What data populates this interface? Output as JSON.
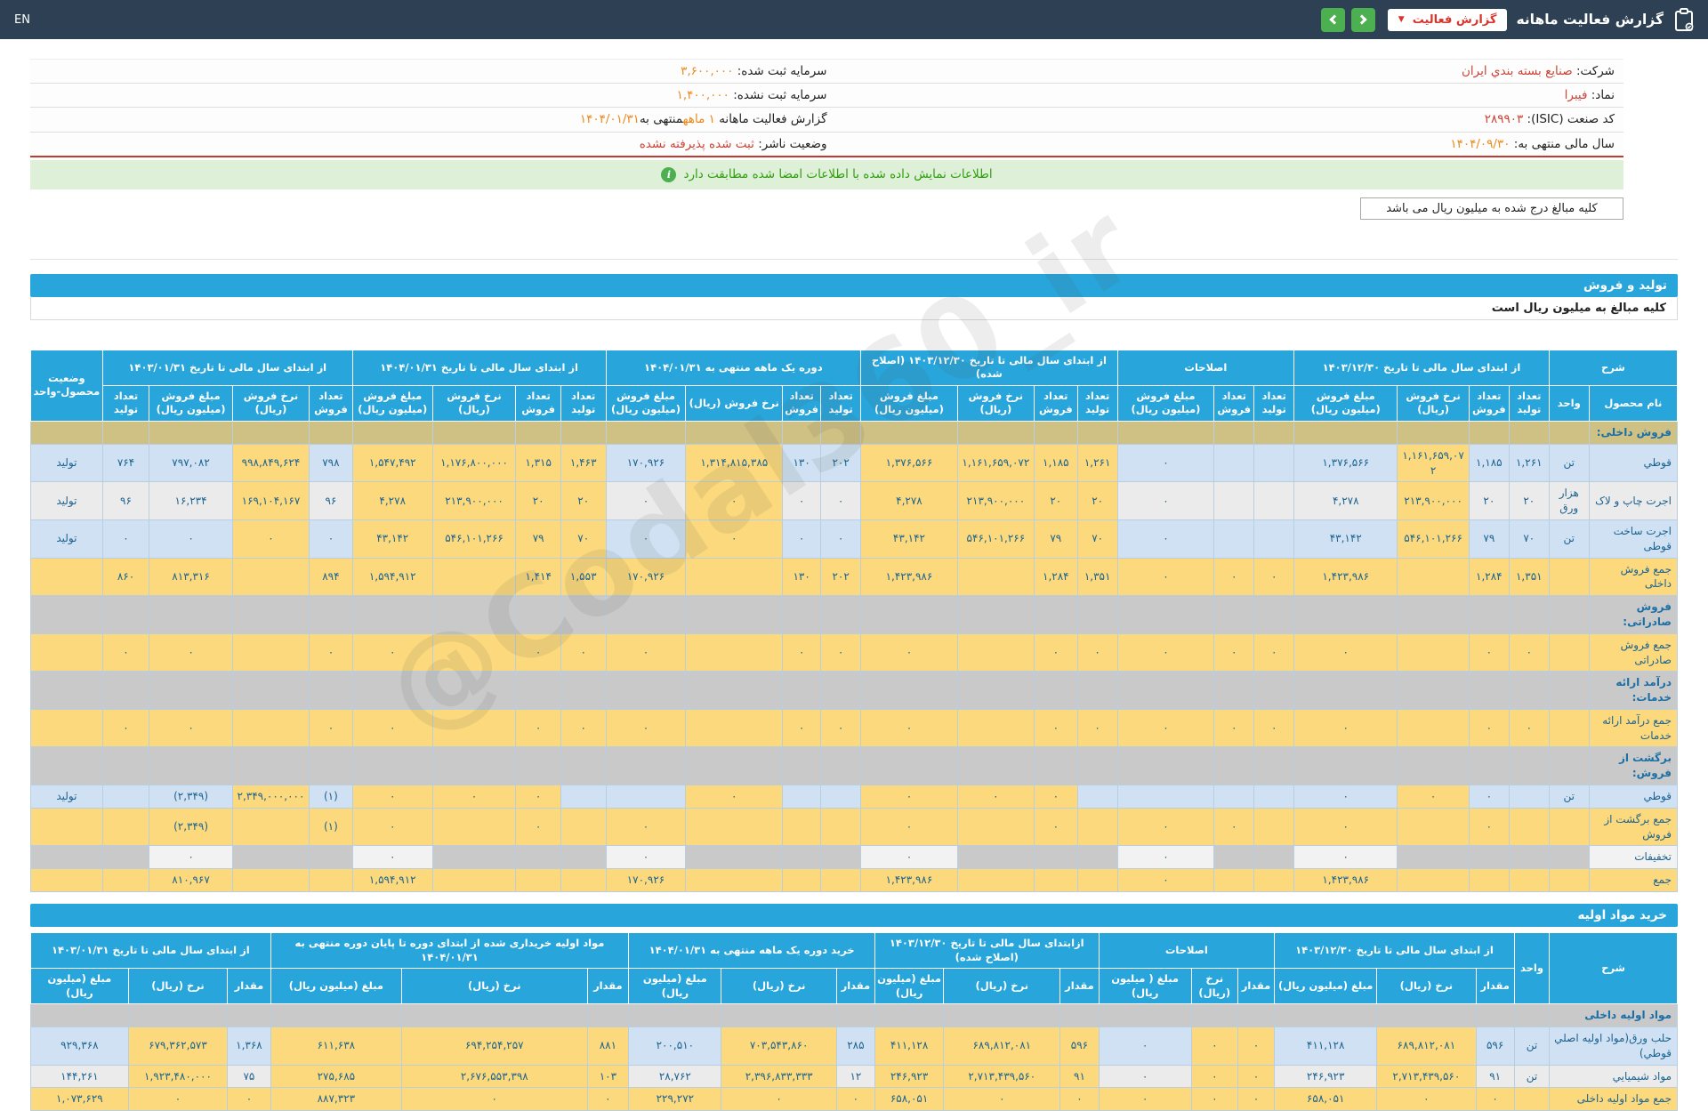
{
  "header": {
    "title": "گزارش فعالیت ماهانه",
    "dropdown_label": "گزارش فعالیت",
    "en_label": "EN",
    "icons": [
      "clipboard-icon",
      "chevron-left-icon",
      "chevron-right-icon",
      "caret-down-icon",
      "info-icon"
    ]
  },
  "info": {
    "rows": [
      [
        [
          {
            "t": "شرکت: ",
            "c": "lbl"
          },
          {
            "t": "صنایع بسته بندي ایران",
            "c": "red"
          }
        ],
        [
          {
            "t": "سرمایه ثبت شده: ",
            "c": "lbl"
          },
          {
            "t": "۳,۶۰۰,۰۰۰",
            "c": "org"
          }
        ]
      ],
      [
        [
          {
            "t": "نماد: ",
            "c": "lbl"
          },
          {
            "t": "فیبرا",
            "c": "red"
          }
        ],
        [
          {
            "t": "سرمایه ثبت نشده: ",
            "c": "lbl"
          },
          {
            "t": "۱,۴۰۰,۰۰۰",
            "c": "org"
          }
        ]
      ],
      [
        [
          {
            "t": "کد صنعت (ISIC): ",
            "c": "lbl"
          },
          {
            "t": "۲۸۹۹۰۳",
            "c": "red"
          }
        ],
        [
          {
            "t": "گزارش فعالیت ماهانه ",
            "c": "lbl"
          },
          {
            "t": "۱ ماهه",
            "c": "org"
          },
          {
            "t": "منتهی به",
            "c": "lbl"
          },
          {
            "t": "۱۴۰۴/۰۱/۳۱",
            "c": "org"
          }
        ]
      ],
      [
        [
          {
            "t": "سال مالی منتهی به: ",
            "c": "lbl"
          },
          {
            "t": "۱۴۰۴/۰۹/۳۰",
            "c": "org"
          }
        ],
        [
          {
            "t": "وضعیت ناشر: ",
            "c": "lbl"
          },
          {
            "t": "ثبت شده پذیرفته نشده",
            "c": "red"
          }
        ]
      ]
    ]
  },
  "notice": "اطلاعات نمایش داده شده با اطلاعات امضا شده مطابقت دارد",
  "unit_box": "کلیه مبالغ درج شده به میلیون ریال می باشد",
  "section1": {
    "title": "تولید و فروش",
    "subtitle": "کلیه مبالغ به میلیون ریال است"
  },
  "section2": {
    "title": "خرید مواد اولیه"
  },
  "watermark": "@Codal360_ir",
  "table1": {
    "lead": {
      "mode": "group",
      "label": "شرح",
      "cols": [
        "نام محصول",
        "واحد"
      ]
    },
    "status_header": "وضعیت محصول-واحد",
    "groups": [
      {
        "label": "از ابتدای سال مالی تا تاریخ ۱۴۰۳/۱۲/۳۰",
        "cols": [
          "تعداد تولید",
          "تعداد فروش",
          "نرخ فروش (ریال)",
          "مبلغ فروش (میلیون ریال)"
        ],
        "hl": [
          2
        ]
      },
      {
        "label": "اصلاحات",
        "cols": [
          "تعداد تولید",
          "تعداد فروش",
          "مبلغ فروش (میلیون ریال)"
        ],
        "hl": []
      },
      {
        "label": "از ابتدای سال مالی تا تاریخ ۱۴۰۳/۱۲/۳۰ (اصلاح شده)",
        "cols": [
          "تعداد تولید",
          "تعداد فروش",
          "نرخ فروش (ریال)",
          "مبلغ فروش (میلیون ریال)"
        ],
        "hl": [
          0,
          1,
          2,
          3
        ]
      },
      {
        "label": "دوره یک ماهه منتهی به ۱۴۰۴/۰۱/۳۱",
        "cols": [
          "تعداد تولید",
          "تعداد فروش",
          "نرخ فروش (ریال)",
          "مبلغ فروش (میلیون ریال)"
        ],
        "hl": [
          2
        ]
      },
      {
        "label": "از ابتدای سال مالی تا تاریخ ۱۴۰۴/۰۱/۳۱",
        "cols": [
          "تعداد تولید",
          "تعداد فروش",
          "نرخ فروش (ریال)",
          "مبلغ فروش (میلیون ریال)"
        ],
        "hl": [
          0,
          1,
          2,
          3
        ]
      },
      {
        "label": "از ابتدای سال مالی تا تاریخ ۱۴۰۳/۰۱/۳۱",
        "cols": [
          "تعداد فروش",
          "نرخ فروش (ریال)",
          "مبلغ فروش (میلیون ریال)",
          "تعداد تولید"
        ],
        "hl": [
          1
        ]
      }
    ],
    "rows": [
      {
        "type": "section",
        "variant": "tan",
        "label": "فروش داخلی:"
      },
      {
        "type": "data",
        "zebra": "blue",
        "cells": [
          "قوطي",
          "تن",
          "۱,۲۶۱",
          "۱,۱۸۵",
          "۱,۱۶۱,۶۵۹,۰۷۲",
          "۱,۳۷۶,۵۶۶",
          "",
          "",
          "۰",
          "۱,۲۶۱",
          "۱,۱۸۵",
          "۱,۱۶۱,۶۵۹,۰۷۲",
          "۱,۳۷۶,۵۶۶",
          "۲۰۲",
          "۱۳۰",
          "۱,۳۱۴,۸۱۵,۳۸۵",
          "۱۷۰,۹۲۶",
          "۱,۴۶۳",
          "۱,۳۱۵",
          "۱,۱۷۶,۸۰۰,۰۰۰",
          "۱,۵۴۷,۴۹۲",
          "۷۹۸",
          "۹۹۸,۸۴۹,۶۲۴",
          "۷۹۷,۰۸۲",
          "۷۶۴",
          "تولید"
        ]
      },
      {
        "type": "data",
        "zebra": "gray",
        "cells": [
          "اجرت چاپ و لاک",
          "هزار ورق",
          "۲۰",
          "۲۰",
          "۲۱۳,۹۰۰,۰۰۰",
          "۴,۲۷۸",
          "",
          "",
          "۰",
          "۲۰",
          "۲۰",
          "۲۱۳,۹۰۰,۰۰۰",
          "۴,۲۷۸",
          "۰",
          "۰",
          "۰",
          "۰",
          "۲۰",
          "۲۰",
          "۲۱۳,۹۰۰,۰۰۰",
          "۴,۲۷۸",
          "۹۶",
          "۱۶۹,۱۰۴,۱۶۷",
          "۱۶,۲۳۴",
          "۹۶",
          "تولید"
        ]
      },
      {
        "type": "data",
        "zebra": "blue",
        "cells": [
          "اجرت ساخت قوطی",
          "تن",
          "۷۰",
          "۷۹",
          "۵۴۶,۱۰۱,۲۶۶",
          "۴۳,۱۴۲",
          "",
          "",
          "۰",
          "۷۰",
          "۷۹",
          "۵۴۶,۱۰۱,۲۶۶",
          "۴۳,۱۴۲",
          "۰",
          "۰",
          "۰",
          "۰",
          "۷۰",
          "۷۹",
          "۵۴۶,۱۰۱,۲۶۶",
          "۴۳,۱۴۲",
          "۰",
          "۰",
          "۰",
          "۰",
          "تولید"
        ]
      },
      {
        "type": "total",
        "cells": [
          "جمع فروش داخلی",
          "",
          "۱,۳۵۱",
          "۱,۲۸۴",
          "",
          "۱,۴۲۳,۹۸۶",
          "۰",
          "۰",
          "۰",
          "۱,۳۵۱",
          "۱,۲۸۴",
          "",
          "۱,۴۲۳,۹۸۶",
          "۲۰۲",
          "۱۳۰",
          "",
          "۱۷۰,۹۲۶",
          "۱,۵۵۳",
          "۱,۴۱۴",
          "",
          "۱,۵۹۴,۹۱۲",
          "۸۹۴",
          "",
          "۸۱۳,۳۱۶",
          "۸۶۰",
          ""
        ]
      },
      {
        "type": "section",
        "variant": "gray",
        "label": "فروش صادراتی:"
      },
      {
        "type": "total",
        "cells": [
          "جمع فروش صادراتی",
          "",
          "۰",
          "۰",
          "",
          "۰",
          "۰",
          "۰",
          "۰",
          "۰",
          "۰",
          "",
          "۰",
          "۰",
          "۰",
          "",
          "۰",
          "۰",
          "۰",
          "",
          "۰",
          "۰",
          "",
          "۰",
          "۰",
          ""
        ]
      },
      {
        "type": "section",
        "variant": "gray",
        "label": "درآمد ارائه خدمات:"
      },
      {
        "type": "total",
        "cells": [
          "جمع درآمد ارائه خدمات",
          "",
          "۰",
          "۰",
          "",
          "۰",
          "۰",
          "۰",
          "۰",
          "۰",
          "۰",
          "",
          "۰",
          "۰",
          "۰",
          "",
          "۰",
          "۰",
          "۰",
          "",
          "۰",
          "۰",
          "",
          "۰",
          "۰",
          ""
        ]
      },
      {
        "type": "section",
        "variant": "gray",
        "label": "برگشت از فروش:"
      },
      {
        "type": "data",
        "zebra": "blue",
        "cells": [
          "قوطي",
          "تن",
          "",
          "۰",
          "۰",
          "۰",
          "",
          "",
          "",
          "",
          "۰",
          "۰",
          "۰",
          "",
          "",
          "۰",
          "",
          "",
          "۰",
          "۰",
          "۰",
          "(۱)",
          "۲,۳۴۹,۰۰۰,۰۰۰",
          "(۲,۳۴۹)",
          "",
          "تولید"
        ]
      },
      {
        "type": "total",
        "cells": [
          "جمع برگشت از فروش",
          "",
          "",
          "۰",
          "",
          "۰",
          "",
          "۰",
          "۰",
          "",
          "۰",
          "",
          "۰",
          "",
          "",
          "",
          "۰",
          "",
          "۰",
          "",
          "۰",
          "(۱)",
          "",
          "(۲,۳۴۹)",
          "",
          ""
        ]
      },
      {
        "type": "disc",
        "cells": [
          "تخفیفات",
          "",
          "",
          "",
          "",
          "۰",
          "",
          "",
          "۰",
          "",
          "",
          "",
          "۰",
          "",
          "",
          "",
          "۰",
          "",
          "",
          "",
          "۰",
          "",
          "",
          "۰",
          "",
          ""
        ]
      },
      {
        "type": "total",
        "cells": [
          "جمع",
          "",
          "",
          "",
          "",
          "۱,۴۲۳,۹۸۶",
          "",
          "",
          "۰",
          "",
          "",
          "",
          "۱,۴۲۳,۹۸۶",
          "",
          "",
          "",
          "۱۷۰,۹۲۶",
          "",
          "",
          "",
          "۱,۵۹۴,۹۱۲",
          "",
          "",
          "۸۱۰,۹۶۷",
          "",
          ""
        ]
      }
    ]
  },
  "table2": {
    "lead": {
      "mode": "rowspan",
      "cols": [
        "شرح",
        "واحد"
      ]
    },
    "groups": [
      {
        "label": "از ابتدای سال مالی تا تاریخ ۱۴۰۳/۱۲/۳۰",
        "cols": [
          "مقدار",
          "نرخ (ریال)",
          "مبلغ (میلیون ریال)"
        ],
        "hl": [
          1
        ]
      },
      {
        "label": "اصلاحات",
        "cols": [
          "مقدار",
          "نرخ (ریال)",
          "مبلغ ( میلیون ریال)"
        ],
        "hl": [
          0,
          1
        ]
      },
      {
        "label": "ازابتدای سال مالی تا تاریخ ۱۴۰۳/۱۲/۳۰ (اصلاح شده)",
        "cols": [
          "مقدار",
          "نرخ (ریال)",
          "مبلغ (میلیون ریال)"
        ],
        "hl": [
          0,
          1,
          2
        ]
      },
      {
        "label": "خرید دوره یک ماهه منتهی به ۱۴۰۴/۰۱/۳۱",
        "cols": [
          "مقدار",
          "نرخ (ریال)",
          "مبلغ (میلیون ریال)"
        ],
        "hl": [
          1
        ]
      },
      {
        "label": "مواد اولیه خریداری شده از ابتدای دوره تا پایان دوره منتهی به ۱۴۰۴/۰۱/۳۱",
        "cols": [
          "مقدار",
          "نرخ (ریال)",
          "مبلغ (میلیون ریال)"
        ],
        "hl": [
          0,
          1,
          2
        ]
      },
      {
        "label": "از ابتدای سال مالی تا تاریخ ۱۴۰۳/۰۱/۳۱",
        "cols": [
          "مقدار",
          "نرخ (ریال)",
          "مبلغ (میلیون ریال)"
        ],
        "hl": [
          1
        ]
      }
    ],
    "rows": [
      {
        "type": "section",
        "variant": "gray",
        "label": "مواد اولیه داخلی"
      },
      {
        "type": "data",
        "zebra": "blue",
        "cells": [
          "حلب ورق(مواد اولیه اصلي قوطي)",
          "تن",
          "۵۹۶",
          "۶۸۹,۸۱۲,۰۸۱",
          "۴۱۱,۱۲۸",
          "۰",
          "۰",
          "۰",
          "۵۹۶",
          "۶۸۹,۸۱۲,۰۸۱",
          "۴۱۱,۱۲۸",
          "۲۸۵",
          "۷۰۳,۵۴۳,۸۶۰",
          "۲۰۰,۵۱۰",
          "۸۸۱",
          "۶۹۴,۲۵۴,۲۵۷",
          "۶۱۱,۶۳۸",
          "۱,۳۶۸",
          "۶۷۹,۳۶۲,۵۷۳",
          "۹۲۹,۳۶۸"
        ]
      },
      {
        "type": "data",
        "zebra": "gray",
        "cells": [
          "مواد شیمیایي",
          "تن",
          "۹۱",
          "۲,۷۱۳,۴۳۹,۵۶۰",
          "۲۴۶,۹۲۳",
          "۰",
          "۰",
          "۰",
          "۹۱",
          "۲,۷۱۳,۴۳۹,۵۶۰",
          "۲۴۶,۹۲۳",
          "۱۲",
          "۲,۳۹۶,۸۳۳,۳۳۳",
          "۲۸,۷۶۲",
          "۱۰۳",
          "۲,۶۷۶,۵۵۳,۳۹۸",
          "۲۷۵,۶۸۵",
          "۷۵",
          "۱,۹۲۳,۴۸۰,۰۰۰",
          "۱۴۴,۲۶۱"
        ]
      },
      {
        "type": "total",
        "cells": [
          "جمع مواد اولیه داخلی",
          "",
          "۰",
          "۰",
          "۶۵۸,۰۵۱",
          "۰",
          "۰",
          "۰",
          "۰",
          "۰",
          "۶۵۸,۰۵۱",
          "۰",
          "۰",
          "۲۲۹,۲۷۲",
          "۰",
          "۰",
          "۸۸۷,۳۲۳",
          "۰",
          "۰",
          "۱,۰۷۳,۶۲۹"
        ]
      }
    ]
  }
}
